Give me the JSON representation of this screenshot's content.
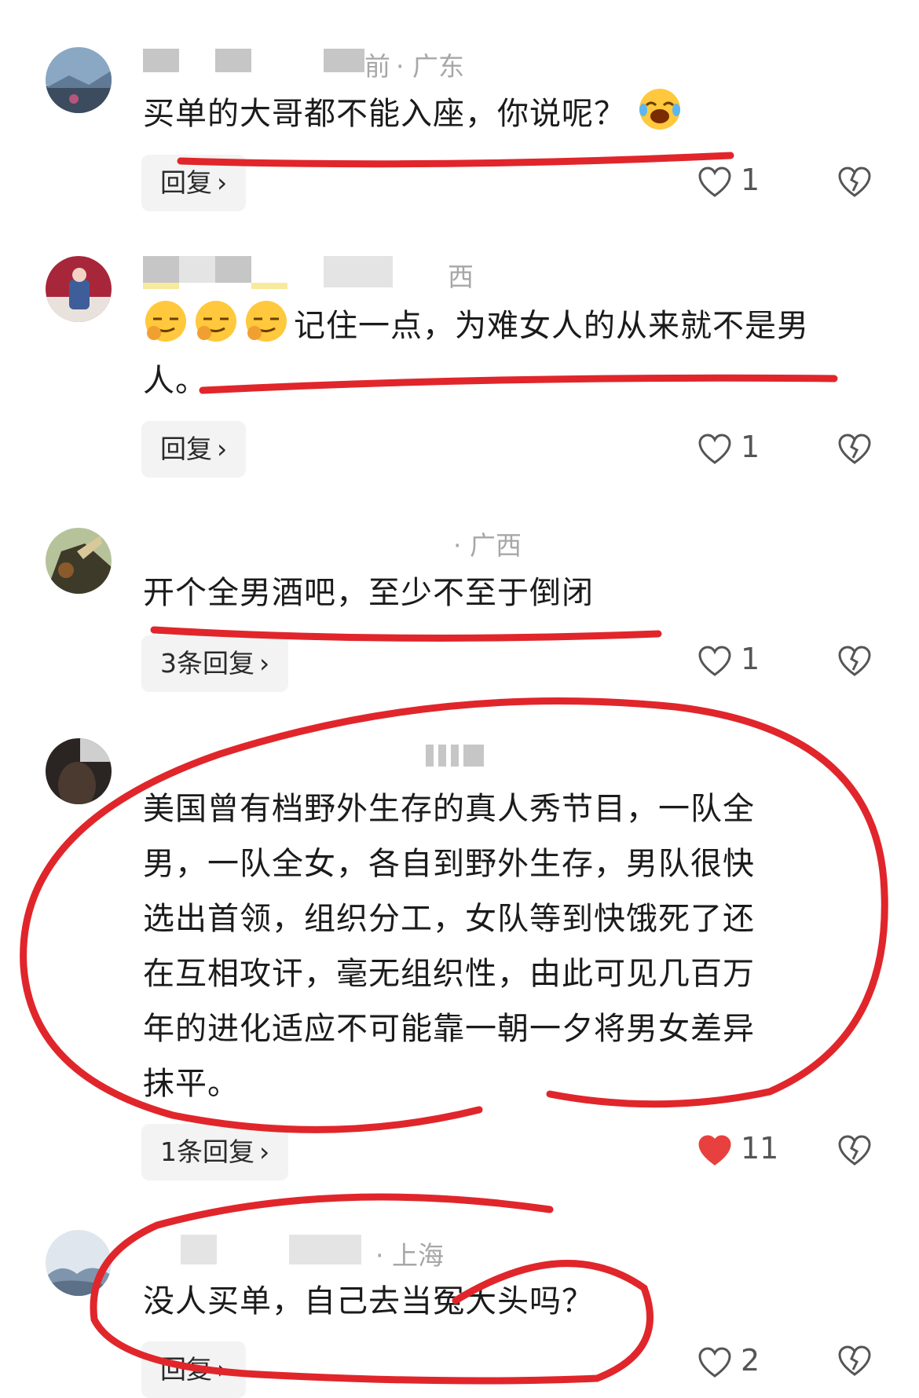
{
  "colors": {
    "annotation_red": "#e0262b",
    "liked_red": "#e8403e",
    "meta_gray": "#a7a7a7"
  },
  "comments": [
    {
      "location": "· 广东",
      "meta_partial": "前",
      "text": "买单的大哥都不能入座，你说呢？",
      "emoji": "laughing-crying-emoji",
      "reply_label": "回复",
      "likes": "1",
      "liked": false
    },
    {
      "location": "西",
      "text": "记住一点，为难女人的从来就不是男人。",
      "emoji": "smug-face-emoji",
      "reply_label": "回复",
      "likes": "1",
      "liked": false
    },
    {
      "location": "· 广西",
      "text": "开个全男酒吧，至少不至于倒闭",
      "reply_label": "3条回复",
      "likes": "1",
      "liked": false
    },
    {
      "location": "",
      "text_lines": [
        "美国曾有档野外生存的真人秀节目，一队全",
        "男，一队全女，各自到野外生存，男队很快",
        "选出首领，组织分工，女队等到快饿死了还",
        "在互相攻讦，毫无组织性，由此可见几百万",
        "年的进化适应不可能靠一朝一夕将男女差异",
        "抹平。"
      ],
      "reply_label": "1条回复",
      "likes": "11",
      "liked": true
    },
    {
      "location": "· 上海",
      "text": "没人买单，自己去当冤大头吗？",
      "reply_label": "回复",
      "likes": "2",
      "liked": false
    }
  ],
  "icons": {
    "chevron": "›",
    "like": "heart-outline-icon",
    "liked": "heart-filled-icon",
    "dislike": "broken-heart-icon"
  }
}
